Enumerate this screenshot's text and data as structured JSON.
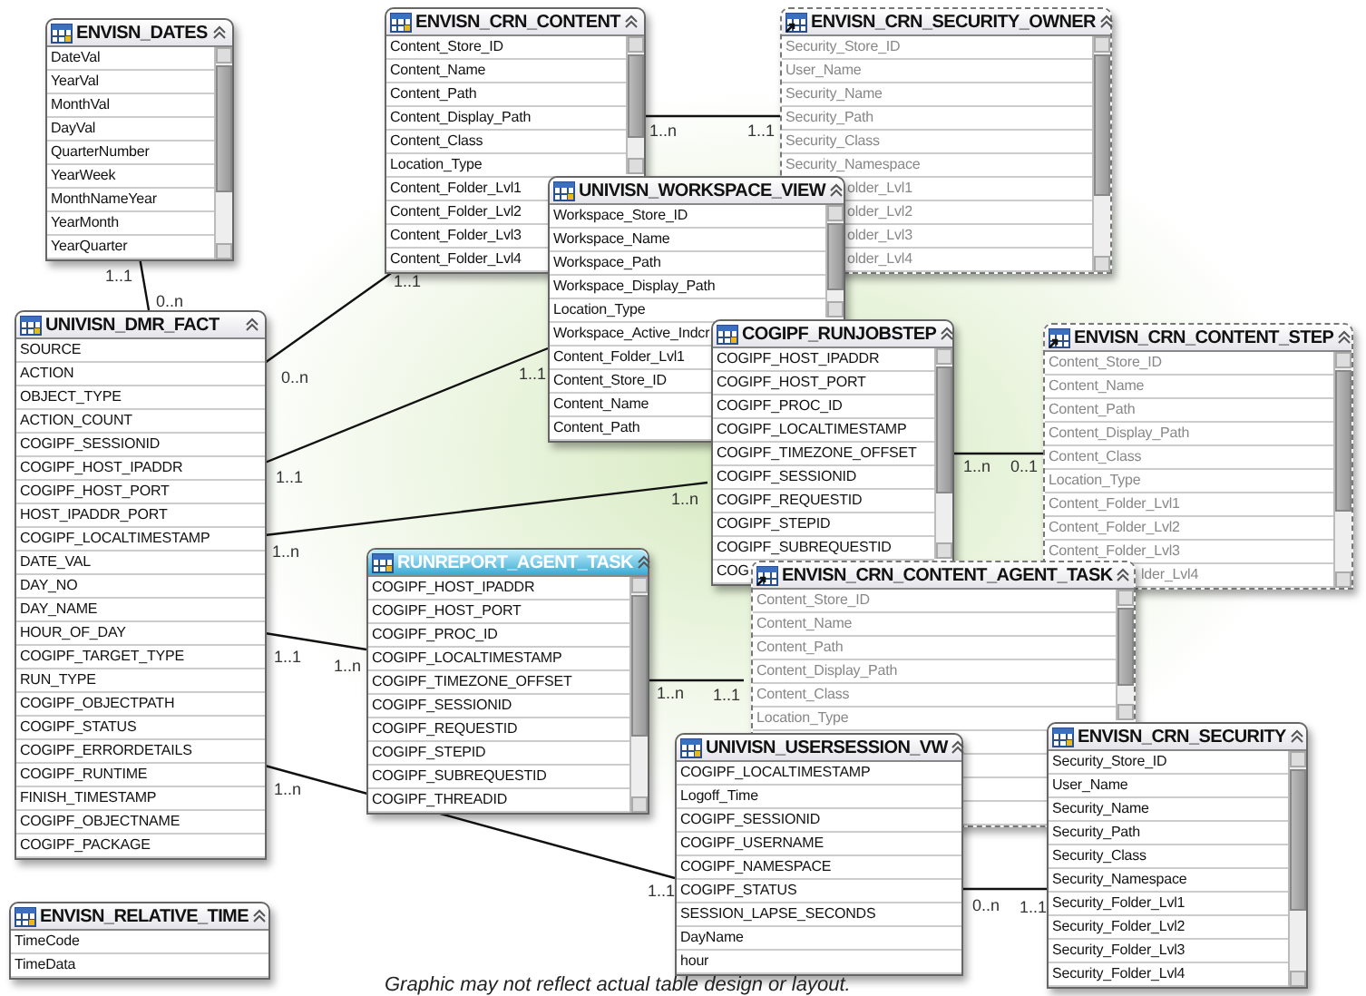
{
  "tables": [
    {
      "title": "ENVISN_DATES",
      "kind": "table",
      "selected": false,
      "scrollable": true,
      "rows": [
        "DateVal",
        "YearVal",
        "MonthVal",
        "DayVal",
        "QuarterNumber",
        "YearWeek",
        "MonthNameYear",
        "YearMonth",
        "YearQuarter"
      ]
    },
    {
      "title": "ENVISN_CRN_CONTENT",
      "kind": "table",
      "selected": false,
      "scrollable": true,
      "rows": [
        "Content_Store_ID",
        "Content_Name",
        "Content_Path",
        "Content_Display_Path",
        "Content_Class",
        "Location_Type",
        "Content_Folder_Lvl1",
        "Content_Folder_Lvl2",
        "Content_Folder_Lvl3",
        "Content_Folder_Lvl4"
      ]
    },
    {
      "title": "ENVISN_CRN_SECURITY_OWNER",
      "kind": "shortcut",
      "selected": false,
      "scrollable": true,
      "rows": [
        "Security_Store_ID",
        "User_Name",
        "Security_Name",
        "Security_Path",
        "Security_Class",
        "Security_Namespace"
      ],
      "partial_rows": [
        "older_Lvl1",
        "older_Lvl2",
        "older_Lvl3",
        "older_Lvl4"
      ]
    },
    {
      "title": "UNIVISN_WORKSPACE_VIEW",
      "kind": "table",
      "selected": false,
      "scrollable": true,
      "rows": [
        "Workspace_Store_ID",
        "Workspace_Name",
        "Workspace_Path",
        "Workspace_Display_Path",
        "Location_Type",
        "Workspace_Active_Indcr",
        "Content_Folder_Lvl1",
        "Content_Store_ID",
        "Content_Name",
        "Content_Path"
      ]
    },
    {
      "title": "COGIPF_RUNJOBSTEP",
      "kind": "table",
      "selected": false,
      "scrollable": true,
      "rows": [
        "COGIPF_HOST_IPADDR",
        "COGIPF_HOST_PORT",
        "COGIPF_PROC_ID",
        "COGIPF_LOCALTIMESTAMP",
        "COGIPF_TIMEZONE_OFFSET",
        "COGIPF_SESSIONID",
        "COGIPF_REQUESTID",
        "COGIPF_STEPID",
        "COGIPF_SUBREQUESTID"
      ],
      "partial_rows": [
        "COG"
      ]
    },
    {
      "title": "ENVISN_CRN_CONTENT_STEP",
      "kind": "shortcut",
      "selected": false,
      "scrollable": true,
      "rows": [
        "Content_Store_ID",
        "Content_Name",
        "Content_Path",
        "Content_Display_Path",
        "Content_Class",
        "Location_Type",
        "Content_Folder_Lvl1",
        "Content_Folder_Lvl2",
        "Content_Folder_Lvl3"
      ],
      "partial_rows": [
        "lder_Lvl4"
      ]
    },
    {
      "title": "ENVISN_CRN_CONTENT_AGENT_TASK",
      "kind": "shortcut",
      "selected": false,
      "scrollable": true,
      "rows": [
        "Content_Store_ID",
        "Content_Name",
        "Content_Path",
        "Content_Display_Path",
        "Content_Class",
        "Location_Type"
      ]
    },
    {
      "title": "RUNREPORT_AGENT_TASK",
      "kind": "table",
      "selected": true,
      "scrollable": true,
      "rows": [
        "COGIPF_HOST_IPADDR",
        "COGIPF_HOST_PORT",
        "COGIPF_PROC_ID",
        "COGIPF_LOCALTIMESTAMP",
        "COGIPF_TIMEZONE_OFFSET",
        "COGIPF_SESSIONID",
        "COGIPF_REQUESTID",
        "COGIPF_STEPID",
        "COGIPF_SUBREQUESTID",
        "COGIPF_THREADID"
      ]
    },
    {
      "title": "UNIVISN_DMR_FACT",
      "kind": "table",
      "selected": false,
      "scrollable": false,
      "rows": [
        "SOURCE",
        "ACTION",
        "OBJECT_TYPE",
        "ACTION_COUNT",
        "COGIPF_SESSIONID",
        "COGIPF_HOST_IPADDR",
        "COGIPF_HOST_PORT",
        "HOST_IPADDR_PORT",
        "COGIPF_LOCALTIMESTAMP",
        "DATE_VAL",
        "DAY_NO",
        "DAY_NAME",
        "HOUR_OF_DAY",
        "COGIPF_TARGET_TYPE",
        "RUN_TYPE",
        "COGIPF_OBJECTPATH",
        "COGIPF_STATUS",
        "COGIPF_ERRORDETAILS",
        "COGIPF_RUNTIME",
        "FINISH_TIMESTAMP",
        "COGIPF_OBJECTNAME",
        "COGIPF_PACKAGE"
      ]
    },
    {
      "title": "UNIVISN_USERSESSION_VW",
      "kind": "table",
      "selected": false,
      "scrollable": false,
      "rows": [
        "COGIPF_LOCALTIMESTAMP",
        "Logoff_Time",
        "COGIPF_SESSIONID",
        "COGIPF_USERNAME",
        "COGIPF_NAMESPACE",
        "COGIPF_STATUS",
        "SESSION_LAPSE_SECONDS",
        "DayName",
        "hour"
      ]
    },
    {
      "title": "ENVISN_CRN_SECURITY",
      "kind": "table",
      "selected": false,
      "scrollable": true,
      "rows": [
        "Security_Store_ID",
        "User_Name",
        "Security_Name",
        "Security_Path",
        "Security_Class",
        "Security_Namespace",
        "Security_Folder_Lvl1",
        "Security_Folder_Lvl2",
        "Security_Folder_Lvl3",
        "Security_Folder_Lvl4"
      ]
    },
    {
      "title": "ENVISN_RELATIVE_TIME",
      "kind": "table",
      "selected": false,
      "scrollable": false,
      "rows": [
        "TimeCode",
        "TimeData"
      ]
    }
  ],
  "relationships": [
    {
      "start_label": "1..1",
      "end_label": "0..n"
    },
    {
      "start_label": "1..1",
      "end_label": "0..n"
    },
    {
      "start_label": "1..n",
      "end_label": "1..1"
    },
    {
      "start_label": "1..1",
      "end_label": "1..1"
    },
    {
      "start_label": "1..n",
      "end_label": "1..n"
    },
    {
      "start_label": "1..n",
      "end_label": "0..1"
    },
    {
      "start_label": "1..1",
      "end_label": "1..n"
    },
    {
      "start_label": "1..n",
      "end_label": "1..1"
    },
    {
      "start_label": "1..n",
      "end_label": "1..1"
    },
    {
      "start_label": "0..n",
      "end_label": "1..1"
    }
  ],
  "caption": "Graphic may not reflect actual table design or layout."
}
